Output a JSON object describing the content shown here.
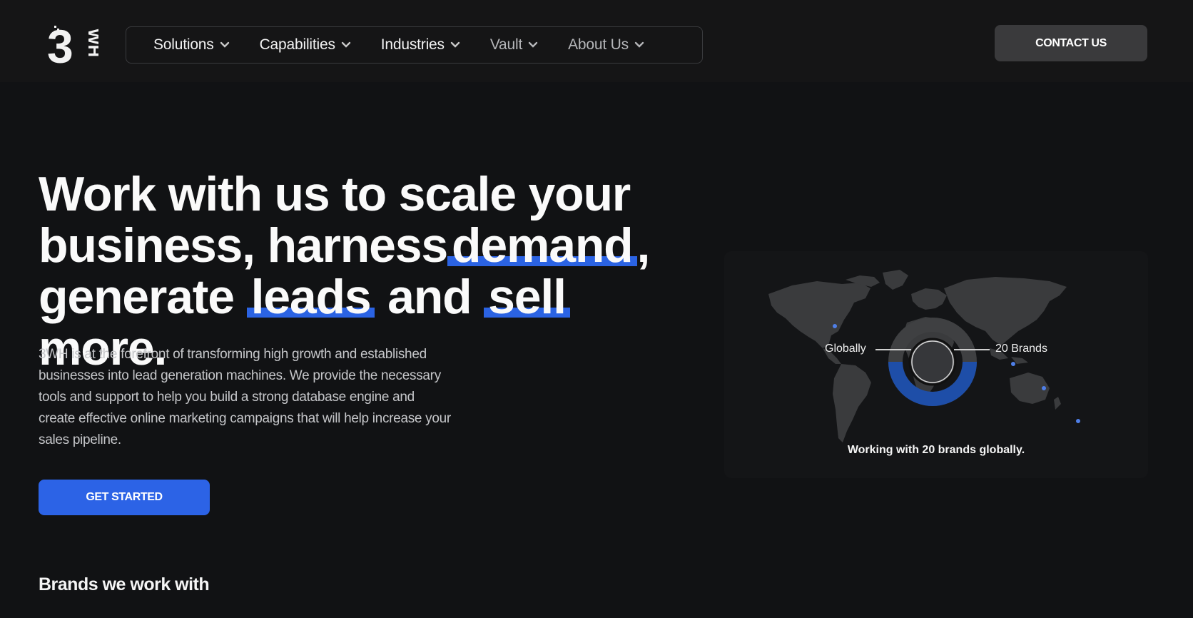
{
  "header": {
    "logo_text": "3WH",
    "nav": [
      {
        "label": "Solutions"
      },
      {
        "label": "Capabilities"
      },
      {
        "label": "Industries"
      },
      {
        "label": "Vault"
      },
      {
        "label": "About Us"
      }
    ],
    "contact_label": "CONTACT US"
  },
  "hero": {
    "title_part1": "Work with us to scale your business, harness",
    "title_hl1": "demand",
    "title_part2": ",",
    "title_part3": "generate",
    "title_hl2": "leads",
    "title_part4": "and",
    "title_hl3": "sell",
    "title_part5": "more.",
    "description": "3WH is at the forefront of transforming high growth and established businesses into lead generation machines. We provide the necessary tools and support to help you build a strong database engine and create effective online marketing campaigns that will help increase your sales pipeline.",
    "cta_label": "GET STARTED"
  },
  "map": {
    "label_left": "Globally",
    "label_right": "20 Brands",
    "caption": "Working with 20 brands globally.",
    "accent_color": "#1e4ea8"
  },
  "brands": {
    "title": "Brands we work with"
  },
  "colors": {
    "accent": "#2c63e6",
    "background": "#111214"
  }
}
